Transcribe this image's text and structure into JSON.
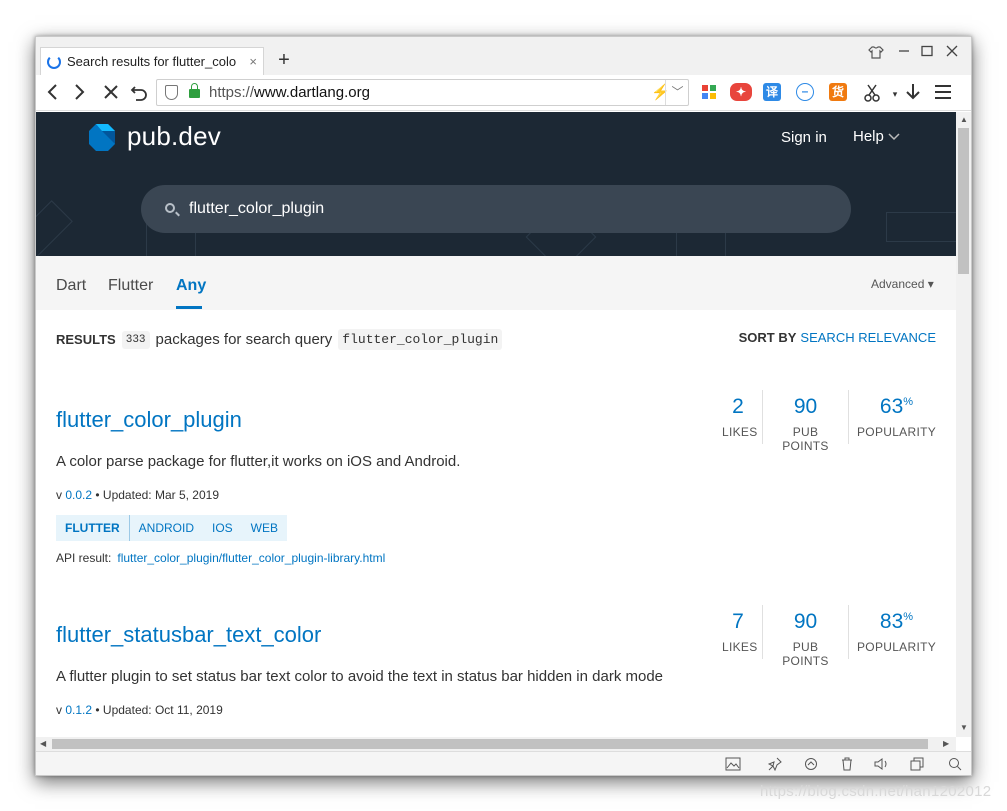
{
  "browser": {
    "tab_title": "Search results for flutter_colo",
    "tab_close": "×",
    "new_tab": "+",
    "url_protocol": "https://",
    "url_host": "www.dartlang.org",
    "ext_translate": "译",
    "ext_coupon": "货"
  },
  "site": {
    "logo": "pub.dev",
    "sign_in": "Sign in",
    "help": "Help",
    "search_value": "flutter_color_plugin",
    "nav": [
      "Dart",
      "Flutter",
      "Any"
    ],
    "advanced": "Advanced ▾"
  },
  "results": {
    "label": "RESULTS",
    "count": "333",
    "text": "packages for search query",
    "query": "flutter_color_plugin",
    "sort_label": "SORT BY",
    "sort_value": "SEARCH RELEVANCE"
  },
  "packages": [
    {
      "name": "flutter_color_plugin",
      "description": "A color parse package for flutter,it works on iOS and Android.",
      "version_prefix": "v ",
      "version": "0.0.2",
      "updated": " • Updated: Mar 5, 2019",
      "tags": [
        "FLUTTER",
        "ANDROID",
        "IOS",
        "WEB"
      ],
      "api_label": "API result:",
      "api_link": "flutter_color_plugin/flutter_color_plugin-library.html",
      "likes": "2",
      "points": "90",
      "popularity": "63",
      "likes_label": "LIKES",
      "points_label": "PUB POINTS",
      "popularity_label": "POPULARITY",
      "pct": "%"
    },
    {
      "name": "flutter_statusbar_text_color",
      "description": "A flutter plugin to set status bar text color to avoid the text in status bar hidden in dark mode",
      "version_prefix": "v ",
      "version": "0.1.2",
      "updated": " • Updated: Oct 11, 2019",
      "likes": "7",
      "points": "90",
      "popularity": "83",
      "likes_label": "LIKES",
      "points_label": "PUB POINTS",
      "popularity_label": "POPULARITY",
      "pct": "%"
    }
  ],
  "watermark": "https://blog.csdn.net/han1202012"
}
